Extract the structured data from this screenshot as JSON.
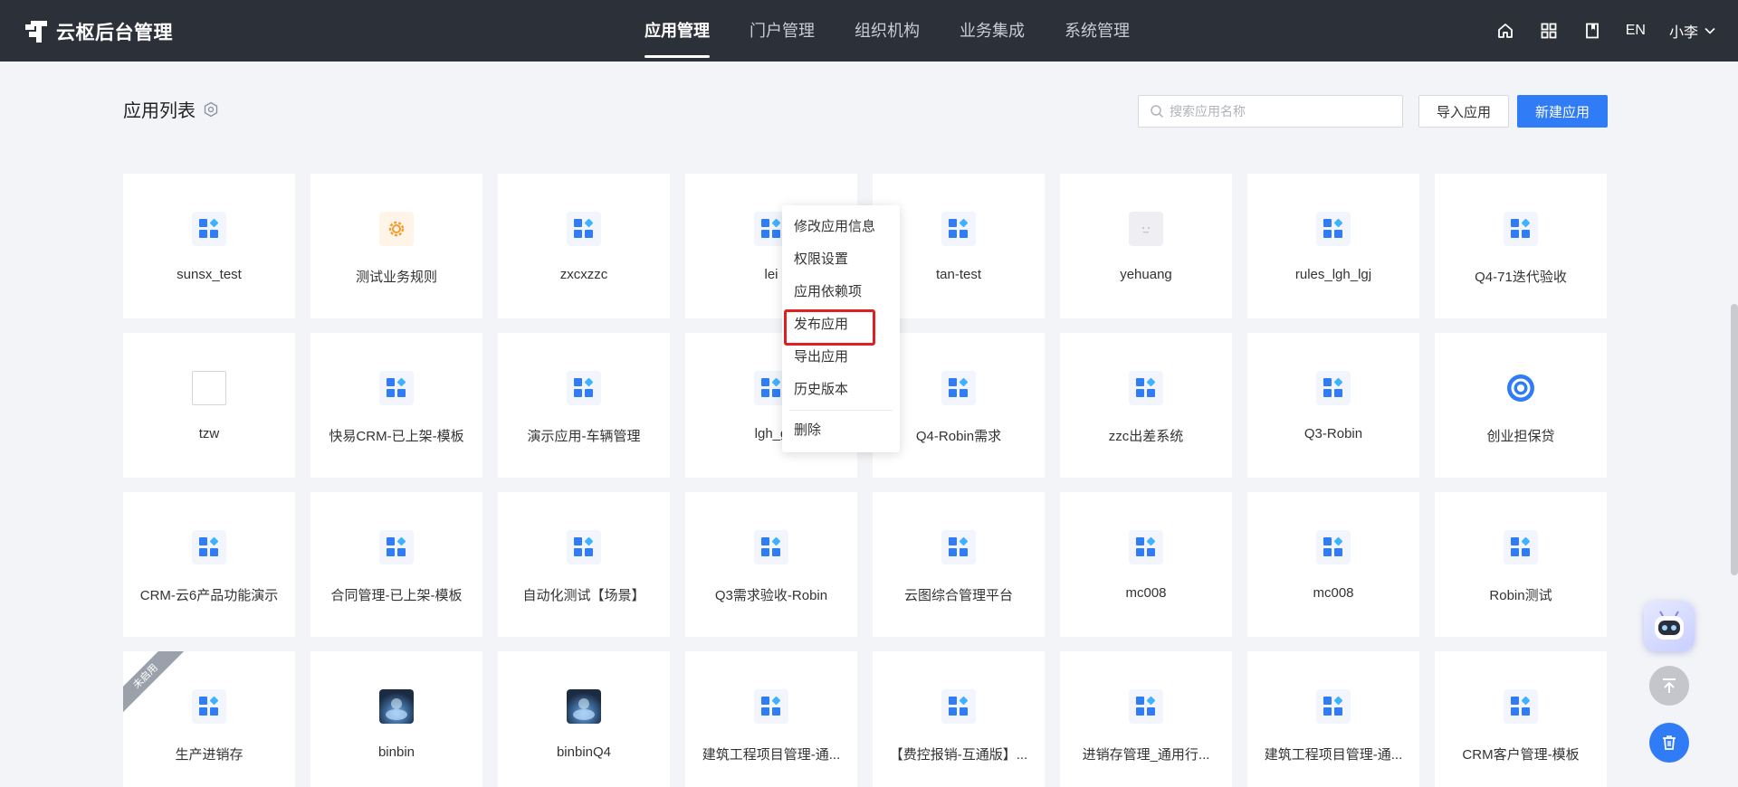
{
  "app": {
    "title": "云枢后台管理"
  },
  "nav": {
    "items": [
      "应用管理",
      "门户管理",
      "组织机构",
      "业务集成",
      "系统管理"
    ],
    "active": 0
  },
  "topbar": {
    "lang": "EN",
    "user": "小李",
    "icons": [
      "home-icon",
      "grid-icon",
      "book-icon"
    ]
  },
  "page": {
    "title": "应用列表",
    "search_placeholder": "搜索应用名称",
    "import_label": "导入应用",
    "new_label": "新建应用"
  },
  "apps": [
    {
      "name": "sunsx_test",
      "icon": "blocks"
    },
    {
      "name": "测试业务规则",
      "icon": "gear"
    },
    {
      "name": "zxcxzzc",
      "icon": "blocks"
    },
    {
      "name": "lei",
      "icon": "blocks"
    },
    {
      "name": "tan-test",
      "icon": "blocks"
    },
    {
      "name": "yehuang",
      "icon": "face"
    },
    {
      "name": "rules_lgh_lgj",
      "icon": "blocks"
    },
    {
      "name": "Q4-71迭代验收",
      "icon": "blocks"
    },
    {
      "name": "tzw",
      "icon": "broken"
    },
    {
      "name": "快易CRM-已上架-模板",
      "icon": "blocks"
    },
    {
      "name": "演示应用-车辆管理",
      "icon": "blocks"
    },
    {
      "name": "lgh_g",
      "icon": "blocks"
    },
    {
      "name": "Q4-Robin需求",
      "icon": "blocks"
    },
    {
      "name": "zzc出差系统",
      "icon": "blocks"
    },
    {
      "name": "Q3-Robin",
      "icon": "blocks"
    },
    {
      "name": "创业担保贷",
      "icon": "round"
    },
    {
      "name": "CRM-云6产品功能演示",
      "icon": "blocks"
    },
    {
      "name": "合同管理-已上架-模板",
      "icon": "blocks"
    },
    {
      "name": "自动化测试【场景】",
      "icon": "blocks"
    },
    {
      "name": "Q3需求验收-Robin",
      "icon": "blocks"
    },
    {
      "name": "云图综合管理平台",
      "icon": "blocks"
    },
    {
      "name": "mc008",
      "icon": "blocks"
    },
    {
      "name": "mc008",
      "icon": "blocks"
    },
    {
      "name": "Robin测试",
      "icon": "blocks"
    },
    {
      "name": "生产进销存",
      "icon": "blocks",
      "ribbon": "未启用"
    },
    {
      "name": "binbin",
      "icon": "photo"
    },
    {
      "name": "binbinQ4",
      "icon": "photo"
    },
    {
      "name": "建筑工程项目管理-通...",
      "icon": "blocks"
    },
    {
      "name": "【费控报销-互通版】...",
      "icon": "blocks"
    },
    {
      "name": "进销存管理_通用行...",
      "icon": "blocks"
    },
    {
      "name": "建筑工程项目管理-通...",
      "icon": "blocks"
    },
    {
      "name": "CRM客户管理-模板",
      "icon": "blocks"
    }
  ],
  "context_menu": {
    "items": [
      "修改应用信息",
      "权限设置",
      "应用依赖项",
      "发布应用",
      "导出应用",
      "历史版本"
    ],
    "danger_item": "删除",
    "highlighted": "发布应用"
  },
  "colors": {
    "primary": "#2f7cf6",
    "topbar": "#2c3038",
    "highlight": "#e02020"
  }
}
